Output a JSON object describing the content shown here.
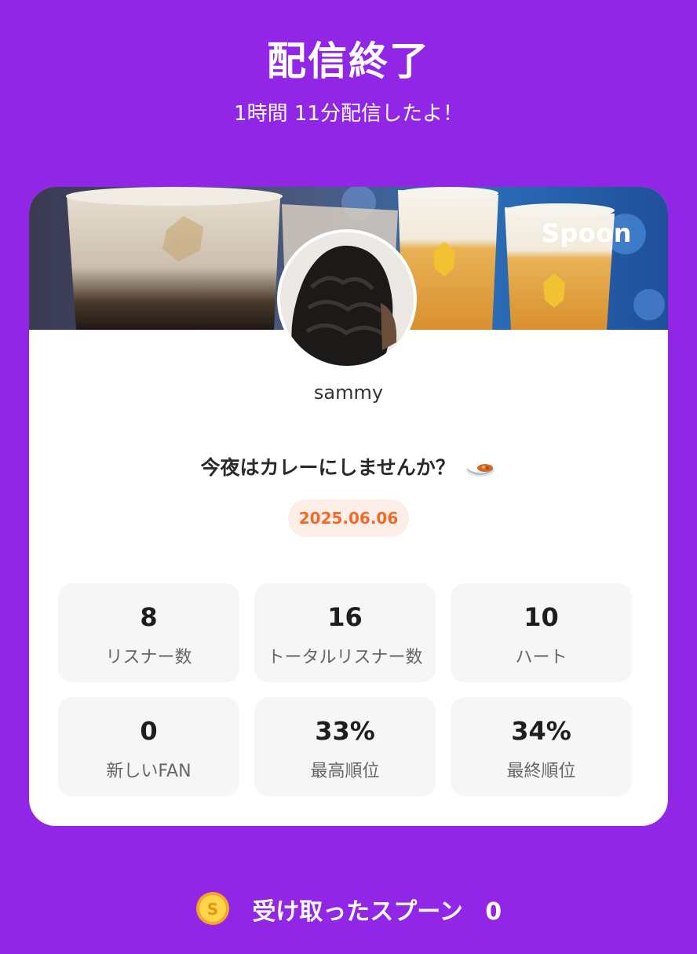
{
  "header": {
    "title": "配信終了",
    "subtitle": "1時間 11分配信したよ！"
  },
  "card": {
    "brand": "Spoon",
    "username": "sammy",
    "stream_title": "今夜はカレーにしませんか？",
    "title_emoji_icon": "curry-rice-icon",
    "date": "2025.06.06",
    "stats": [
      {
        "value": "8",
        "label": "リスナー数"
      },
      {
        "value": "16",
        "label": "トータルリスナー数"
      },
      {
        "value": "10",
        "label": "ハート"
      },
      {
        "value": "0",
        "label": "新しいFAN"
      },
      {
        "value": "33%",
        "label": "最高順位"
      },
      {
        "value": "34%",
        "label": "最終順位"
      }
    ]
  },
  "footer": {
    "coin_icon": "spoon-coin-icon",
    "label": "受け取ったスプーン",
    "count": "0"
  },
  "colors": {
    "background": "#9226e6",
    "card": "#ffffff",
    "stat_box": "#f6f6f6",
    "date_badge_bg": "#fdeee7",
    "date_badge_text": "#f06b2a"
  }
}
